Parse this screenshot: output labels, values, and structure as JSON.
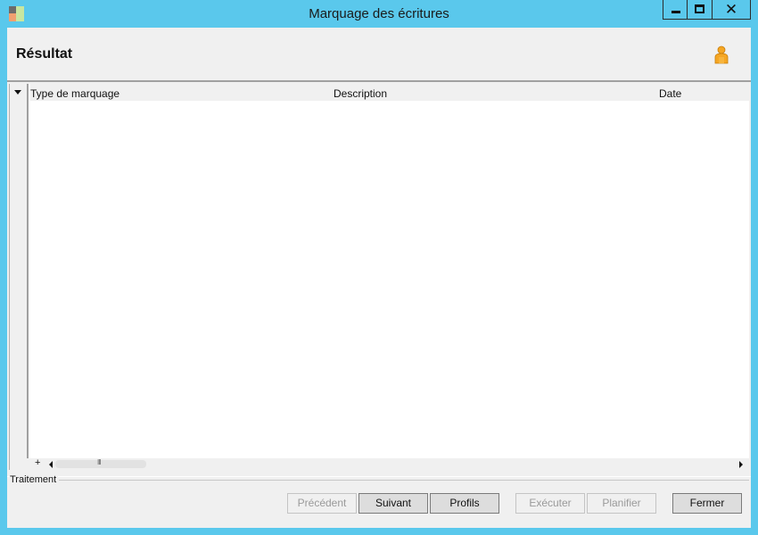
{
  "window": {
    "title": "Marquage des écritures",
    "minimize_label": "",
    "maximize_label": "",
    "close_glyph": "✕",
    "colors": {
      "frame": "#5ac8ec",
      "client": "#f0f0f0"
    }
  },
  "header": {
    "title": "Résultat",
    "user_icon": "user-icon"
  },
  "grid": {
    "columns": [
      "Type de marquage",
      "Description",
      "Date"
    ],
    "rows": [],
    "expand_glyph": "+",
    "scroll_grip": "III"
  },
  "footer": {
    "section_label": "Traitement",
    "buttons": {
      "previous": "Précédent",
      "next": "Suivant",
      "profiles": "Profils",
      "execute": "Exécuter",
      "schedule": "Planifier",
      "close": "Fermer"
    }
  }
}
